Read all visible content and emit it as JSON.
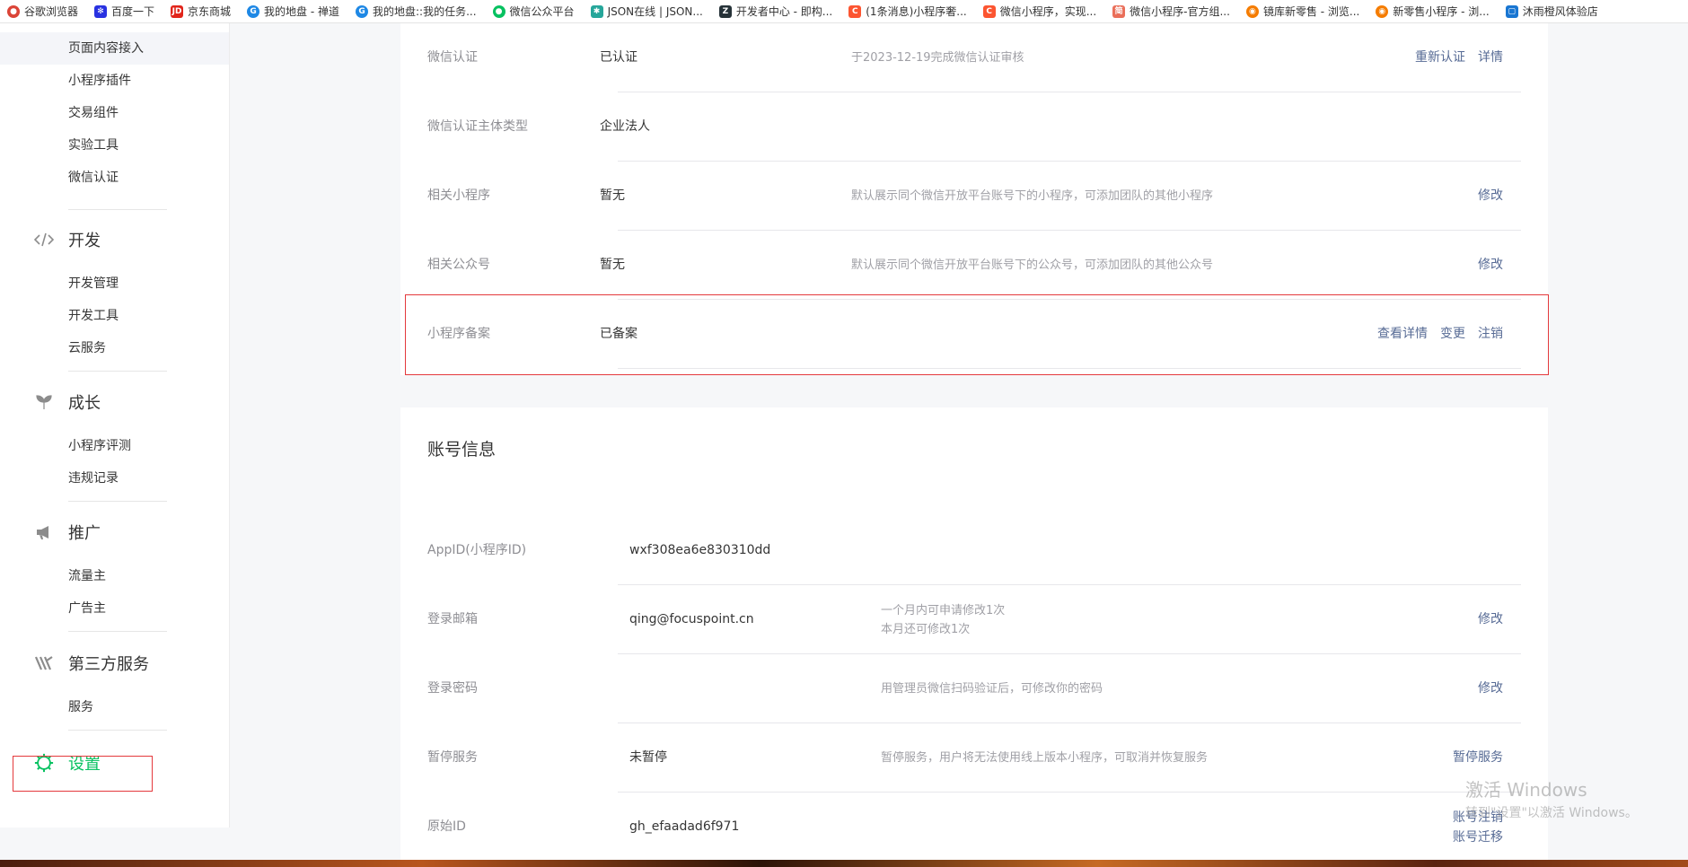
{
  "bookmarks": [
    {
      "label": "谷歌浏览器",
      "icon": "chrome-icon",
      "color": "#db4437",
      "glyph": "●"
    },
    {
      "label": "百度一下",
      "icon": "baidu-paw-icon",
      "color": "#2932e1",
      "glyph": "✻"
    },
    {
      "label": "京东商城",
      "icon": "jd-icon",
      "color": "#e1251b",
      "glyph": "JD"
    },
    {
      "label": "我的地盘 - 禅道",
      "icon": "zentao-icon",
      "color": "#1e88e5",
      "glyph": "G"
    },
    {
      "label": "我的地盘::我的任务...",
      "icon": "zentao-icon",
      "color": "#1e88e5",
      "glyph": "G"
    },
    {
      "label": "微信公众平台",
      "icon": "wechat-icon",
      "color": "#07c160",
      "glyph": "●"
    },
    {
      "label": "JSON在线 | JSON...",
      "icon": "json-gear-icon",
      "color": "#26a69a",
      "glyph": "✱"
    },
    {
      "label": "开发者中心 - 即构...",
      "icon": "zego-icon",
      "color": "#263238",
      "glyph": "Z"
    },
    {
      "label": "(1条消息)小程序奢...",
      "icon": "csdn-icon",
      "color": "#fc5531",
      "glyph": "C"
    },
    {
      "label": "微信小程序，实现...",
      "icon": "csdn-icon",
      "color": "#fc5531",
      "glyph": "C"
    },
    {
      "label": "微信小程序-官方组...",
      "icon": "jianshu-icon",
      "color": "#ea6f5a",
      "glyph": "简"
    },
    {
      "label": "镜库新零售 - 浏览...",
      "icon": "orange-circle-icon",
      "color": "#f57c00",
      "glyph": "◉"
    },
    {
      "label": "新零售小程序 - 浏...",
      "icon": "orange-circle-icon",
      "color": "#f57c00",
      "glyph": "◉"
    },
    {
      "label": "沐雨橙风体验店",
      "icon": "page-icon",
      "color": "#1976d2",
      "glyph": "▢"
    }
  ],
  "sidebar": {
    "top_items": [
      "页面内容接入",
      "小程序插件",
      "交易组件",
      "实验工具",
      "微信认证"
    ],
    "sections": [
      {
        "title": "开发",
        "icon": "code-icon",
        "items": [
          "开发管理",
          "开发工具",
          "云服务"
        ]
      },
      {
        "title": "成长",
        "icon": "sprout-icon",
        "items": [
          "小程序评测",
          "违规记录"
        ]
      },
      {
        "title": "推广",
        "icon": "megaphone-icon",
        "items": [
          "流量主",
          "广告主"
        ]
      },
      {
        "title": "第三方服务",
        "icon": "third-party-icon",
        "items": [
          "服务"
        ]
      }
    ],
    "settings": {
      "title": "设置",
      "icon": "gear-icon"
    }
  },
  "auth_card": {
    "rows": [
      {
        "label": "微信认证",
        "value": "已认证",
        "desc": "于2023-12-19完成微信认证审核",
        "actions": [
          "重新认证",
          "详情"
        ]
      },
      {
        "label": "微信认证主体类型",
        "value": "企业法人",
        "desc": "",
        "actions": []
      },
      {
        "label": "相关小程序",
        "value": "暂无",
        "desc": "默认展示同个微信开放平台账号下的小程序，可添加团队的其他小程序",
        "actions": [
          "修改"
        ]
      },
      {
        "label": "相关公众号",
        "value": "暂无",
        "desc": "默认展示同个微信开放平台账号下的公众号，可添加团队的其他公众号",
        "actions": [
          "修改"
        ]
      },
      {
        "label": "小程序备案",
        "value": "已备案",
        "desc": "",
        "actions": [
          "查看详情",
          "变更",
          "注销"
        ]
      }
    ]
  },
  "account_card": {
    "title": "账号信息",
    "appid": {
      "label": "AppID(小程序ID)",
      "value": "wxf308ea6e830310dd"
    },
    "email": {
      "label": "登录邮箱",
      "value": "qing@focuspoint.cn",
      "desc_line1": "一个月内可申请修改1次",
      "desc_line2": "本月还可修改1次",
      "action": "修改"
    },
    "password": {
      "label": "登录密码",
      "value": "",
      "desc": "用管理员微信扫码验证后，可修改你的密码",
      "action": "修改"
    },
    "suspend": {
      "label": "暂停服务",
      "value": "未暂停",
      "desc": "暂停服务，用户将无法使用线上版本小程序，可取消并恢复服务",
      "action": "暂停服务"
    },
    "original_id": {
      "label": "原始ID",
      "value": "gh_efaadad6f971",
      "action1": "账号注销",
      "action2": "账号迁移"
    }
  },
  "watermark": {
    "line1": "激活 Windows",
    "line2": "转到\"设置\"以激活 Windows。"
  },
  "colors": {
    "link": "#576b95",
    "accent_green": "#07c160",
    "annotation_red": "#e4393c"
  }
}
